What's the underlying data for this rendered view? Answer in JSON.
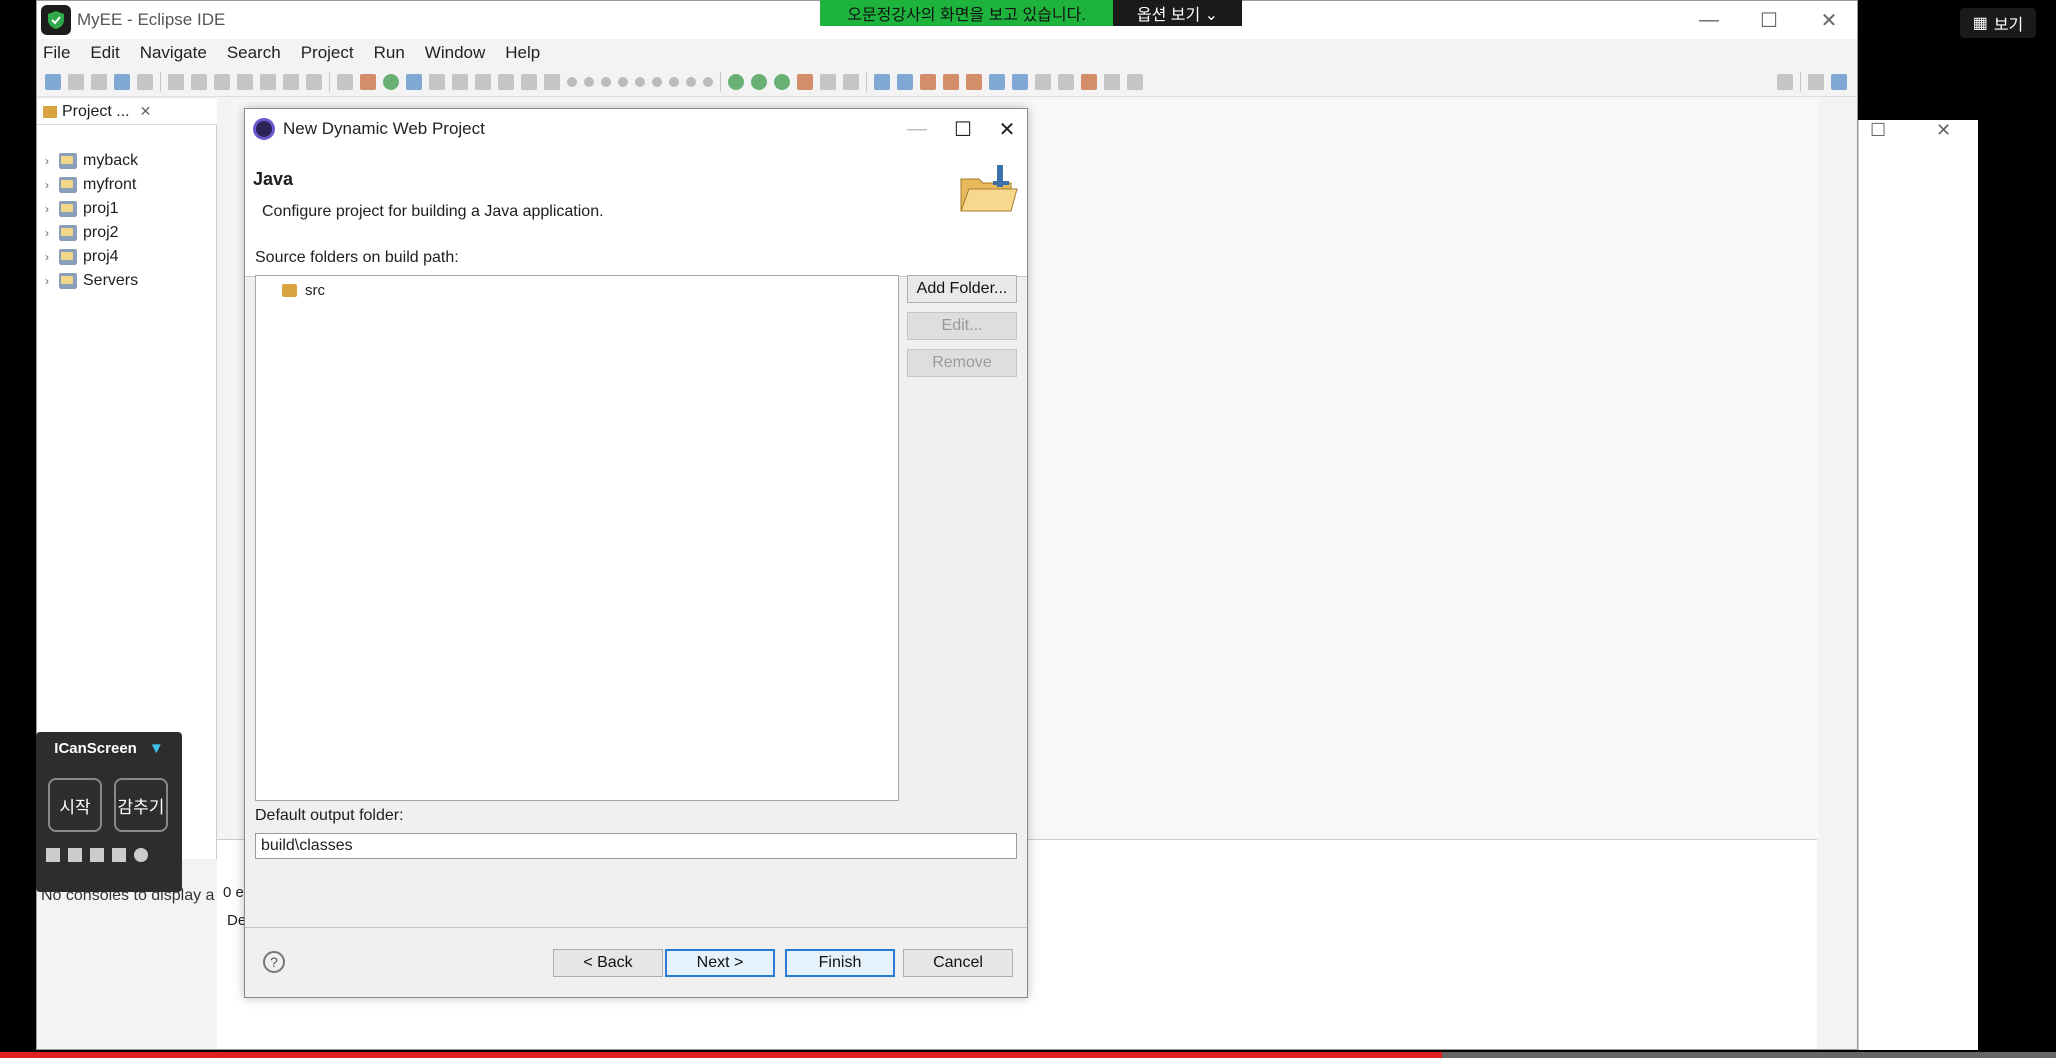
{
  "window": {
    "title": "MyEE - Eclipse IDE",
    "controls": [
      "—",
      "☐",
      "✕"
    ]
  },
  "menu": [
    "File",
    "Edit",
    "Navigate",
    "Search",
    "Project",
    "Run",
    "Window",
    "Help"
  ],
  "project_explorer": {
    "tab_label": "Project ...",
    "items": [
      "myback",
      "myfront",
      "proj1",
      "proj2",
      "proj4",
      "Servers"
    ]
  },
  "console": {
    "message": "No consoles to display a",
    "count_text": "0 e",
    "col_text": "De"
  },
  "dialog": {
    "title": "New Dynamic Web Project",
    "heading": "Java",
    "description": "Configure project for building a Java application.",
    "source_label": "Source folders on build path:",
    "source_items": [
      "src"
    ],
    "add_folder": "Add Folder...",
    "edit": "Edit...",
    "remove": "Remove",
    "output_label": "Default output folder:",
    "output_value": "build\\classes",
    "help": "?",
    "back": "< Back",
    "next": "Next >",
    "finish": "Finish",
    "cancel": "Cancel"
  },
  "overlays": {
    "zoom_banner": "오문정강사의 화면을 보고 있습니다.",
    "zoom_options": "옵션 보기 ⌄",
    "view_button": "보기",
    "icanscreen_title": "ICanScreen",
    "start": "시작",
    "hide": "감추기"
  },
  "colors": {
    "accent_focus": "#2b7bd2",
    "zoom_green": "#1eb33d",
    "progress_red": "#e02020"
  }
}
